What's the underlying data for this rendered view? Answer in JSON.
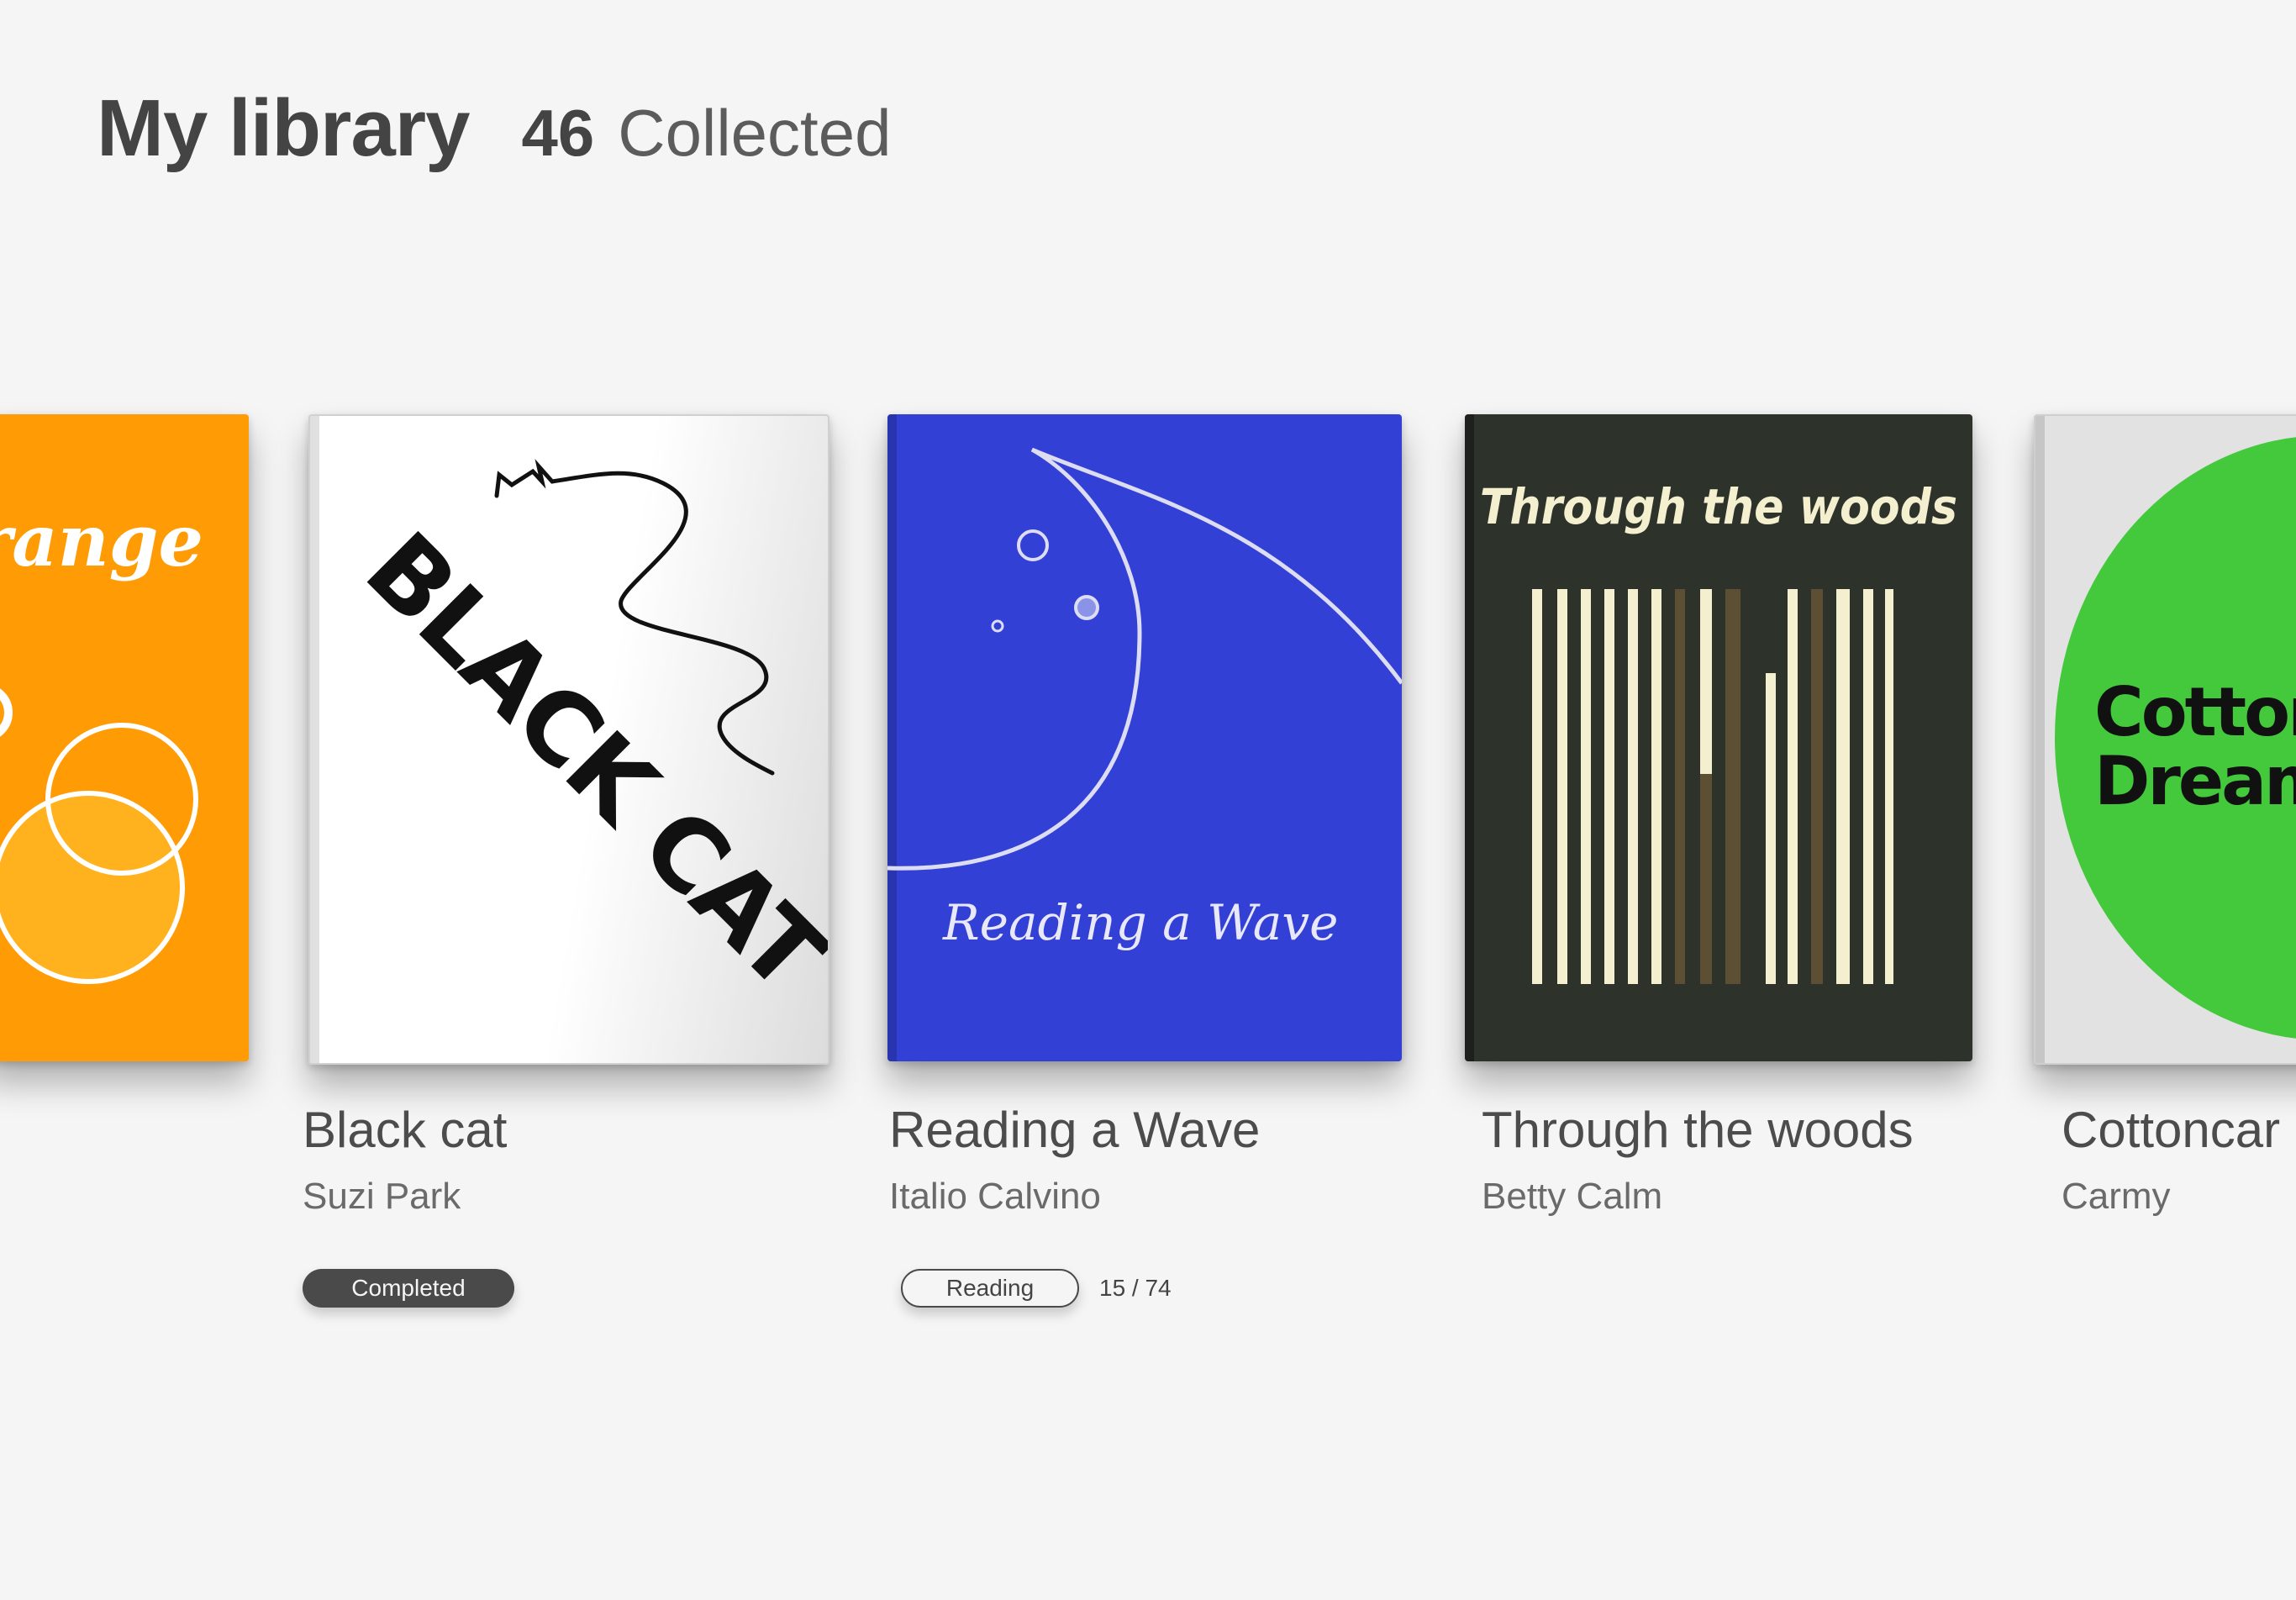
{
  "header": {
    "title": "My library",
    "count": "46",
    "count_label": "Collected"
  },
  "books": [
    {
      "cover_text": "range",
      "cover_color": "#ff9b05",
      "title": "",
      "author": ""
    },
    {
      "cover_text": "BLACK CAT",
      "cover_color": "#ffffff",
      "title": "Black cat",
      "author": "Suzi Park",
      "status": "Completed"
    },
    {
      "cover_text": "Reading a Wave",
      "cover_color": "#3340d6",
      "title": "Reading a Wave",
      "author": "Italio Calvino",
      "status": "Reading",
      "progress": "15 / 74"
    },
    {
      "cover_text": "Through the woods",
      "cover_color": "#2d322b",
      "title": "Through the woods",
      "author": "Betty Calm"
    },
    {
      "cover_text_line1": "Cottonc",
      "cover_text_line2": "Dream",
      "cover_color": "#e2e2e2",
      "accent_color": "#43c93b",
      "title": "Cottoncar",
      "author": "Carmy"
    }
  ]
}
